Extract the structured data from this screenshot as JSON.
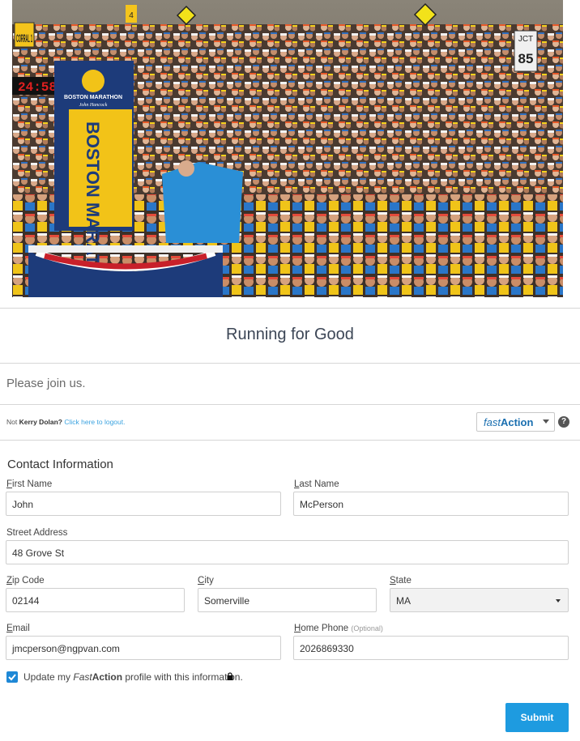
{
  "hero": {
    "banner_brand": "BOSTON MARATHON",
    "banner_sponsor": "John Hancock",
    "banner_side_text": "BOSTON MARATHON",
    "clock": "24:58",
    "corral_sign": "CORRAL 1",
    "route_sign_top": "JCT",
    "route_sign_num": "85",
    "small_sign": "4"
  },
  "form": {
    "title": "Running for Good",
    "intro": "Please join us.",
    "not_prefix": "Not",
    "user_name": "Kerry Dolan?",
    "logout_link": "Click here to logout.",
    "fastaction": {
      "fast": "fast",
      "action": "Action"
    },
    "help_glyph": "?",
    "section_title": "Contact Information",
    "fields": {
      "first_name": {
        "label_u": "F",
        "label_rest": "irst Name",
        "value": "John"
      },
      "last_name": {
        "label_u": "L",
        "label_rest": "ast Name",
        "value": "McPerson"
      },
      "street": {
        "label": "Street Address",
        "value": "48 Grove St"
      },
      "zip": {
        "label_u": "Z",
        "label_rest": "ip Code",
        "value": "02144"
      },
      "city": {
        "label_u": "C",
        "label_rest": "ity",
        "value": "Somerville"
      },
      "state": {
        "label_u": "S",
        "label_rest": "tate",
        "value": "MA"
      },
      "email": {
        "label_u": "E",
        "label_rest": "mail",
        "value": "jmcperson@ngpvan.com"
      },
      "home_phone": {
        "label_u": "H",
        "label_rest": "ome Phone",
        "optional": "(Optional)",
        "value": "2026869330"
      }
    },
    "update_profile": {
      "prefix": "Update my ",
      "fast": "Fast",
      "action": "Action",
      "suffix": " profile with this information.",
      "checked": true
    },
    "submit_label": "Submit"
  },
  "colors": {
    "accent": "#1e9be0",
    "link": "#3ba3e0",
    "title": "#3c4656",
    "banner_blue": "#1d3b7a",
    "banner_yellow": "#f2c318"
  }
}
